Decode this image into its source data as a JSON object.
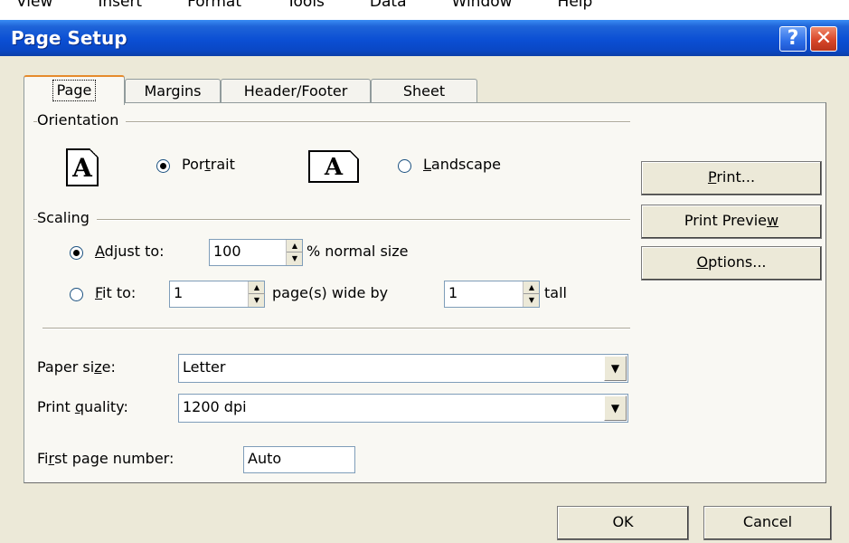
{
  "menubar": {
    "items": [
      "View",
      "Insert",
      "Format",
      "Tools",
      "Data",
      "Window",
      "Help"
    ]
  },
  "window": {
    "title": "Page Setup",
    "help_label": "?",
    "close_label": "✕"
  },
  "tabs": [
    {
      "label": "Page",
      "active": true
    },
    {
      "label": "Margins",
      "active": false
    },
    {
      "label": "Header/Footer",
      "active": false
    },
    {
      "label": "Sheet",
      "active": false
    }
  ],
  "orientation": {
    "group_label": "Orientation",
    "icon_glyph": "A",
    "portrait": {
      "pre": "Por",
      "key": "t",
      "post": "rait",
      "checked": true
    },
    "landscape": {
      "pre": "",
      "key": "L",
      "post": "andscape",
      "checked": false
    }
  },
  "scaling": {
    "group_label": "Scaling",
    "adjust": {
      "pre": "",
      "key": "A",
      "post": "djust to:",
      "checked": true,
      "value": "100",
      "suffix": "% normal size"
    },
    "fit": {
      "pre": "",
      "key": "F",
      "post": "it to:",
      "checked": false,
      "wide_value": "1",
      "wide_suffix": "page(s) wide by",
      "tall_value": "1",
      "tall_suffix": "tall"
    }
  },
  "paper_size": {
    "pre": "Paper si",
    "key": "z",
    "post": "e:",
    "value": "Letter"
  },
  "print_quality": {
    "pre": "Print ",
    "key": "q",
    "post": "uality:",
    "value": "1200 dpi"
  },
  "first_page": {
    "pre": "Fi",
    "key": "r",
    "post": "st page number:",
    "value": "Auto"
  },
  "buttons": {
    "print": {
      "pre": "",
      "key": "P",
      "post": "rint..."
    },
    "preview": {
      "pre": "Print Previe",
      "key": "w",
      "post": ""
    },
    "options": {
      "pre": "",
      "key": "O",
      "post": "ptions..."
    },
    "ok": "OK",
    "cancel": "Cancel"
  },
  "colors": {
    "titlebar": "#0a47c4",
    "dialog_bg": "#ece9d8",
    "radio_checked": "#21a121"
  }
}
